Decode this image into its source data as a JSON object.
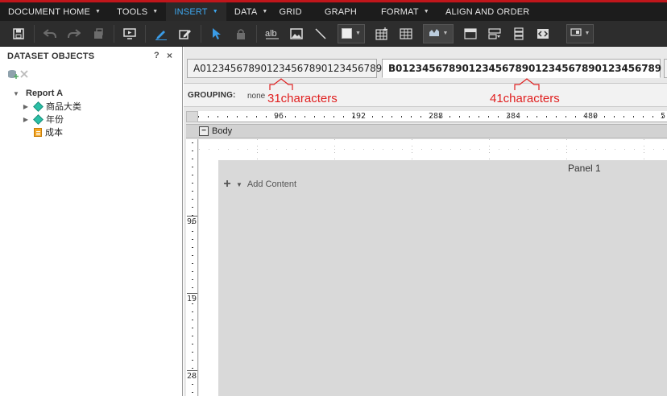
{
  "menubar": {
    "items": [
      {
        "label": "DOCUMENT HOME",
        "has_caret": true,
        "active": false
      },
      {
        "label": "TOOLS",
        "has_caret": true,
        "active": false
      },
      {
        "label": "INSERT",
        "has_caret": true,
        "active": true
      },
      {
        "label": "DATA",
        "has_caret": true,
        "active": false
      },
      {
        "label": "GRID",
        "has_caret": false,
        "active": false
      },
      {
        "label": "GRAPH",
        "has_caret": false,
        "active": false
      },
      {
        "label": "FORMAT",
        "has_caret": true,
        "active": false
      },
      {
        "label": "ALIGN AND ORDER",
        "has_caret": false,
        "active": false
      }
    ],
    "accent_color": "#c0161b",
    "active_color": "#3ea8f0"
  },
  "toolbar": {
    "icons": [
      "save-icon",
      "undo-icon",
      "redo-icon",
      "stamp-icon",
      "presentation-icon",
      "pencil-icon",
      "edit-icon",
      "pointer-icon",
      "lock-icon",
      "text-field-icon",
      "image-icon",
      "line-icon",
      "rectangle-icon",
      "insert-grid-icon",
      "grid-icon",
      "graph-icon",
      "panel-stack-icon",
      "selector-icon",
      "layers-icon",
      "html-container-icon",
      "widget-icon"
    ]
  },
  "left_panel": {
    "title": "DATASET OBJECTS",
    "help": "?",
    "close": "×",
    "tree": {
      "root": "Report A",
      "items": [
        {
          "label": "商品大类",
          "type": "attribute",
          "expandable": true
        },
        {
          "label": "年份",
          "type": "attribute",
          "expandable": true
        },
        {
          "label": "成本",
          "type": "metric",
          "expandable": false
        }
      ]
    }
  },
  "tabs": {
    "items": [
      {
        "label": "A0123456789012345678901234567​89",
        "active": false
      },
      {
        "label": "B0123456789012345678901234567890123456789",
        "active": true
      }
    ]
  },
  "grouping": {
    "label": "GROUPING:",
    "value": "none"
  },
  "annotations": {
    "first": "31characters",
    "second": "41characters",
    "color": "#e02020"
  },
  "ruler": {
    "h_marks": [
      "96",
      "192",
      "288",
      "384",
      "480",
      "5"
    ],
    "v_marks": [
      "96",
      "19",
      "28"
    ]
  },
  "section": {
    "band_label": "Body",
    "toggle": "−"
  },
  "panel": {
    "title": "Panel 1",
    "add_content": "Add Content"
  }
}
